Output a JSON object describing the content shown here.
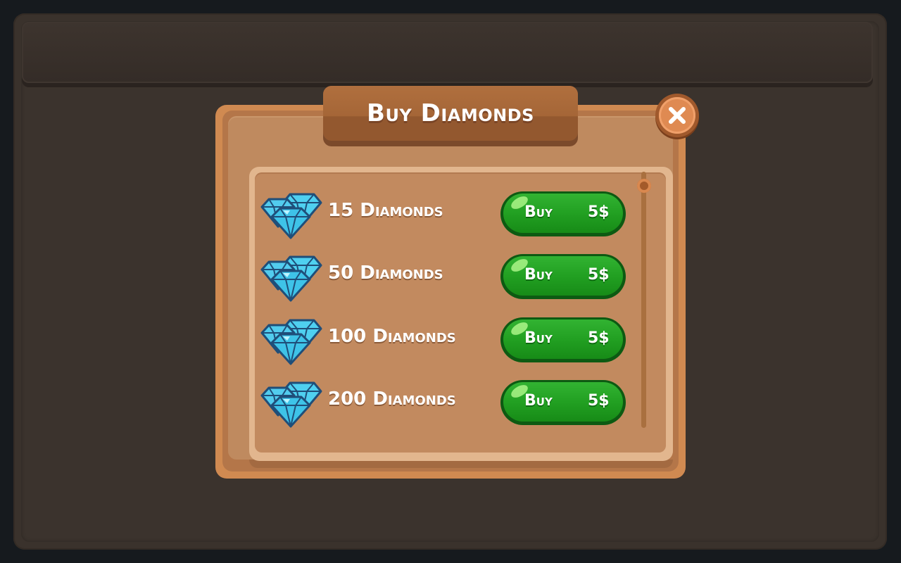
{
  "dialog": {
    "title": "Buy Diamonds",
    "close_icon": "close-icon"
  },
  "items": [
    {
      "label": "15 Diamonds",
      "buy_label": "Buy",
      "price": "5$",
      "icon": "diamonds-icon"
    },
    {
      "label": "50 Diamonds",
      "buy_label": "Buy",
      "price": "5$",
      "icon": "diamonds-icon"
    },
    {
      "label": "100 Diamonds",
      "buy_label": "Buy",
      "price": "5$",
      "icon": "diamonds-icon"
    },
    {
      "label": "200 Diamonds",
      "buy_label": "Buy",
      "price": "5$",
      "icon": "diamonds-icon"
    }
  ],
  "colors": {
    "panel": "#d08a51",
    "buy_button": "#22a022",
    "diamond": "#3ec3e8",
    "background": "#3a322c"
  }
}
